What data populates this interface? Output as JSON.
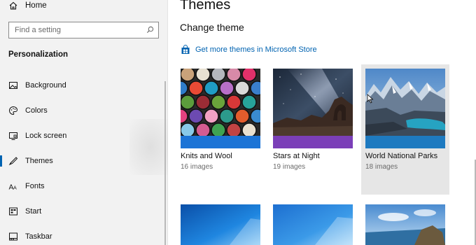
{
  "sidebar": {
    "home_label": "Home",
    "search_placeholder": "Find a setting",
    "section_title": "Personalization",
    "items": [
      {
        "label": "Background",
        "icon": "picture-icon"
      },
      {
        "label": "Colors",
        "icon": "palette-icon"
      },
      {
        "label": "Lock screen",
        "icon": "monitor-icon"
      },
      {
        "label": "Themes",
        "icon": "themes-icon",
        "active": true
      },
      {
        "label": "Fonts",
        "icon": "font-icon"
      },
      {
        "label": "Start",
        "icon": "start-icon"
      },
      {
        "label": "Taskbar",
        "icon": "taskbar-icon"
      }
    ]
  },
  "main": {
    "title": "Themes",
    "subtitle": "Change theme",
    "store_link": "Get more themes in Microsoft Store",
    "themes": [
      {
        "name": "Knits and Wool",
        "count": "16 images",
        "accent": "#1c74d6"
      },
      {
        "name": "Stars at Night",
        "count": "19 images",
        "accent": "#7b3fb8"
      },
      {
        "name": "World National Parks",
        "count": "18 images",
        "accent": "#1e7ac0",
        "selected": true
      }
    ]
  },
  "colors": {
    "accent": "#0063b1",
    "sidebar_bg": "#f2f2f2",
    "selected_tile_bg": "#e6e6e6"
  }
}
